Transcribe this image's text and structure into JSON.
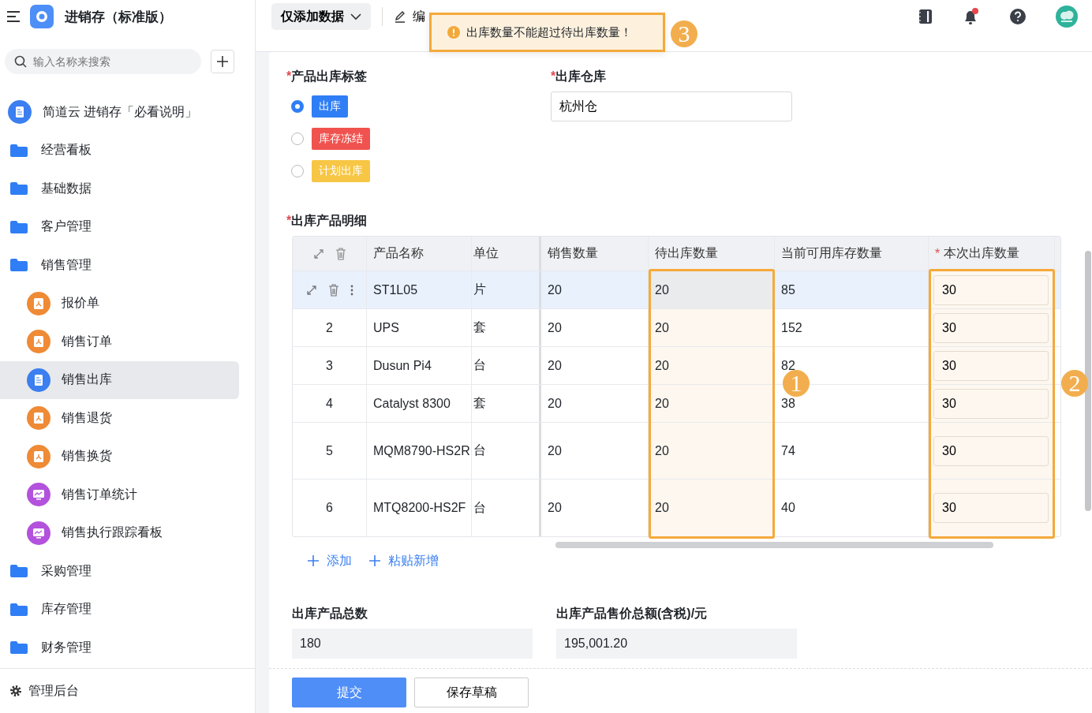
{
  "app": {
    "title": "进销存（标准版）"
  },
  "sidebar": {
    "search": {
      "placeholder": "输入名称来搜索"
    },
    "items": [
      {
        "kind": "doc",
        "label": "简道云 进销存「必看说明」",
        "selected": false
      },
      {
        "kind": "folder",
        "label": "经营看板",
        "selected": false
      },
      {
        "kind": "folder",
        "label": "基础数据",
        "selected": false
      },
      {
        "kind": "folder",
        "label": "客户管理",
        "selected": false
      },
      {
        "kind": "folder",
        "label": "销售管理",
        "selected": false,
        "children": [
          {
            "kind": "form",
            "label": "报价单",
            "color": "#ef8a35",
            "selected": false
          },
          {
            "kind": "form",
            "label": "销售订单",
            "color": "#ef8a35",
            "selected": false
          },
          {
            "kind": "doc",
            "label": "销售出库",
            "color": "#3b7ff0",
            "selected": true
          },
          {
            "kind": "form",
            "label": "销售退货",
            "color": "#ef8a35",
            "selected": false
          },
          {
            "kind": "form",
            "label": "销售换货",
            "color": "#ef8a35",
            "selected": false
          },
          {
            "kind": "chart",
            "label": "销售订单统计",
            "color": "#b352dc",
            "selected": false
          },
          {
            "kind": "chart",
            "label": "销售执行跟踪看板",
            "color": "#b352dc",
            "selected": false
          }
        ]
      },
      {
        "kind": "folder",
        "label": "采购管理",
        "selected": false
      },
      {
        "kind": "folder",
        "label": "库存管理",
        "selected": false
      },
      {
        "kind": "folder",
        "label": "财务管理",
        "selected": false
      }
    ],
    "footer": "管理后台"
  },
  "toolbar": {
    "mode_button": "仅添加数据",
    "edit_button": "编",
    "notifications": true
  },
  "toast": {
    "message": "出库数量不能超过待出库数量！",
    "marker": "3"
  },
  "form": {
    "tag_field": {
      "label": "产品出库标签",
      "required_mark": "*",
      "options": [
        {
          "label": "出库",
          "color": "#2f7ef5",
          "selected": true
        },
        {
          "label": "库存冻结",
          "color": "#f0534f",
          "selected": false
        },
        {
          "label": "计划出库",
          "color": "#f7c644",
          "selected": false
        }
      ]
    },
    "warehouse_field": {
      "label": "出库仓库",
      "required_mark": "*",
      "value": "杭州仓"
    },
    "detail_label": {
      "label": "出库产品明细",
      "required_mark": "*"
    },
    "table": {
      "columns": [
        {
          "label": "产品名称",
          "highlighted": false
        },
        {
          "label": "单位",
          "highlighted": false
        },
        {
          "label": "销售数量",
          "highlighted": false
        },
        {
          "label": "待出库数量",
          "highlighted": true,
          "marker": "1"
        },
        {
          "label": "当前可用库存数量",
          "highlighted": false
        },
        {
          "label": "本次出库数量",
          "required_mark": "*",
          "highlighted": true,
          "marker": "2"
        }
      ],
      "rows": [
        {
          "selected": true,
          "cells": [
            "ST1L05",
            "片",
            "20",
            "20",
            "85",
            "30"
          ]
        },
        {
          "index": "2",
          "selected": false,
          "cells": [
            "UPS",
            "套",
            "20",
            "20",
            "152",
            "30"
          ]
        },
        {
          "index": "3",
          "selected": false,
          "cells": [
            "Dusun Pi4",
            "台",
            "20",
            "20",
            "82",
            "30"
          ]
        },
        {
          "index": "4",
          "selected": false,
          "cells": [
            "Catalyst 8300",
            "套",
            "20",
            "20",
            "38",
            "30"
          ]
        },
        {
          "index": "5",
          "selected": false,
          "tall": true,
          "cells": [
            "MQM8790-HS2R",
            "台",
            "20",
            "20",
            "74",
            "30"
          ]
        },
        {
          "index": "6",
          "selected": false,
          "tall": true,
          "cells": [
            "MTQ8200-HS2F",
            "台",
            "20",
            "20",
            "40",
            "30"
          ]
        }
      ]
    },
    "add_links": [
      "添加",
      "粘贴新增"
    ],
    "totals": [
      {
        "label": "出库产品总数",
        "value": "180"
      },
      {
        "label": "出库产品售价总额(含税)/元",
        "value": "195,001.20"
      }
    ],
    "buttons": {
      "submit": "提交",
      "draft": "保存草稿"
    }
  }
}
